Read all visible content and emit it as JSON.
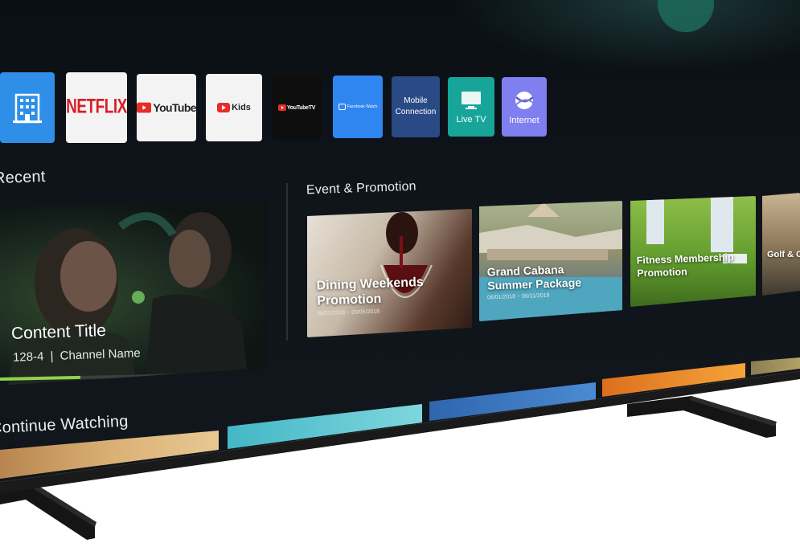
{
  "apps": [
    {
      "id": "building",
      "label": "",
      "icon": "building-icon",
      "color": "#2f8fe8"
    },
    {
      "id": "netflix",
      "label": "NETFLIX",
      "color": "#f3f3f3",
      "text_color": "#d81f26"
    },
    {
      "id": "youtube",
      "label": "YouTube",
      "color": "#f3f3f3",
      "text_color": "#222222"
    },
    {
      "id": "youtube-kids",
      "label": "Kids",
      "color": "#f3f3f3",
      "text_color": "#222222"
    },
    {
      "id": "youtube-tv",
      "label": "YouTubeTV",
      "color": "#0e0e0e",
      "text_color": "#ffffff"
    },
    {
      "id": "facebook-watch",
      "label": "Facebook Watch",
      "color": "#2f86f0",
      "text_color": "#ffffff"
    },
    {
      "id": "mobile-connection",
      "label": "Mobile\nConnection",
      "color": "#2a4a85",
      "text_color": "#ffffff"
    },
    {
      "id": "live-tv",
      "label": "Live TV",
      "color": "#17a59a",
      "text_color": "#ffffff"
    },
    {
      "id": "internet",
      "label": "Internet",
      "color": "#7f7ff0",
      "text_color": "#ffffff"
    }
  ],
  "recent": {
    "heading": "Recent",
    "content_title": "Content Title",
    "channel_number": "128-4",
    "channel_name": "Channel Name",
    "progress": 0.3
  },
  "events": {
    "heading": "Event & Promotion",
    "cards": [
      {
        "title": "Dining Weekends Promotion",
        "date": "06/01/2018 ~ 20/05/2018"
      },
      {
        "title": "Grand Cabana Summer Package",
        "date": "06/01/2018 ~ 06/11/2018"
      },
      {
        "title": "Fitness Membership Promotion",
        "date": ""
      },
      {
        "title": "Golf & Get",
        "date": ""
      }
    ]
  },
  "continue_watching": {
    "heading": "Continue Watching",
    "strip_colors": [
      "#c99a5b",
      "#5cc6cf",
      "#3a72b8",
      "#e8892c"
    ]
  }
}
